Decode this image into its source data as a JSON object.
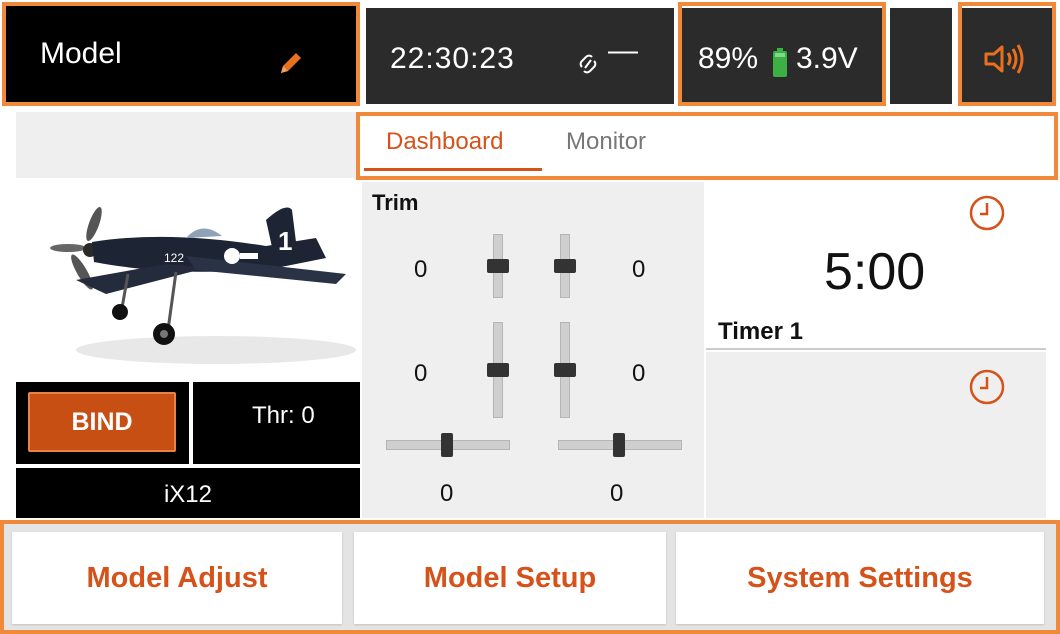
{
  "colors": {
    "accent": "#d5521a",
    "highlight_frame": "#f08a3a",
    "battery": "#3cb043"
  },
  "status_bar": {
    "model_title": "Model",
    "edit_icon": "pencil-icon",
    "time": "22:30:23",
    "link_icon": "link-icon",
    "link_status": "—",
    "battery_percent": "89%",
    "battery_icon": "battery-icon",
    "battery_voltage": "3.9V",
    "sound_icon": "speaker-icon"
  },
  "tabs": [
    {
      "label": "Dashboard",
      "active": true
    },
    {
      "label": "Monitor",
      "active": false
    }
  ],
  "model_panel": {
    "image": "aircraft-photo",
    "bind_label": "BIND",
    "throttle_label": "Thr: 0",
    "receiver_name": "iX12"
  },
  "trim": {
    "title": "Trim",
    "values": {
      "upper_left": "0",
      "upper_right": "0",
      "middle_left": "0",
      "middle_right": "0",
      "bottom_left": "0",
      "bottom_right": "0"
    }
  },
  "timers": {
    "timer1_value": "5:00",
    "timer1_name": "Timer 1",
    "clock_icon": "clock-icon"
  },
  "bottom_nav": {
    "model_adjust": "Model Adjust",
    "model_setup": "Model Setup",
    "system_settings": "System Settings"
  }
}
